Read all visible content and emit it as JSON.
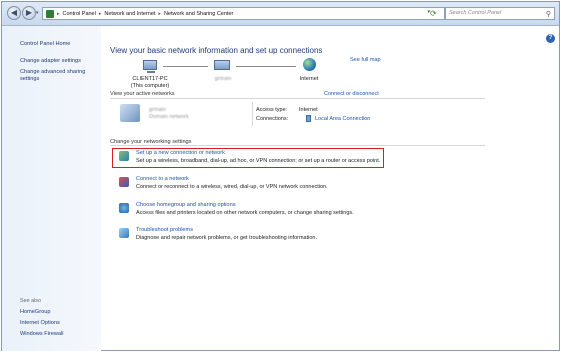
{
  "address_bar": {
    "breadcrumb": [
      "Control Panel",
      "Network and Internet",
      "Network and Sharing Center"
    ],
    "search_placeholder": "Search Control Panel"
  },
  "sidebar": {
    "items": [
      {
        "label": "Control Panel Home"
      },
      {
        "label": "Change adapter settings"
      },
      {
        "label": "Change advanced sharing settings"
      }
    ],
    "see_also_label": "See also",
    "see_also": [
      {
        "label": "HomeGroup"
      },
      {
        "label": "Internet Options"
      },
      {
        "label": "Windows Firewall"
      }
    ]
  },
  "main": {
    "heading": "View your basic network information and set up connections",
    "see_full_map": "See full map",
    "map": {
      "computer_name": "CLIENT17-PC",
      "computer_sub": "(This computer)",
      "network_name": "grmain",
      "internet": "Internet"
    },
    "active_networks_label": "View your active networks",
    "connect_disconnect": "Connect or disconnect",
    "active_network": {
      "name": "grmain",
      "type": "Domain network",
      "access_type_key": "Access type:",
      "access_type_value": "Internet",
      "connections_key": "Connections:",
      "connections_value": "Local Area Connection"
    },
    "change_settings_label": "Change your networking settings",
    "tasks": [
      {
        "title": "Set up a new connection or network",
        "desc": "Set up a wireless, broadband, dial-up, ad hoc, or VPN connection; or set up a router or access point.",
        "highlighted": true
      },
      {
        "title": "Connect to a network",
        "desc": "Connect or reconnect to a wireless, wired, dial-up, or VPN network connection."
      },
      {
        "title": "Choose homegroup and sharing options",
        "desc": "Access files and printers located on other network computers, or change sharing settings."
      },
      {
        "title": "Troubleshoot problems",
        "desc": "Diagnose and repair network problems, or get troubleshooting information."
      }
    ]
  },
  "colors": {
    "link": "#1a55b0",
    "heading": "#1f3b7a",
    "highlight_border": "#d81e1e",
    "sidebar_bg": "#eaf1fa"
  }
}
